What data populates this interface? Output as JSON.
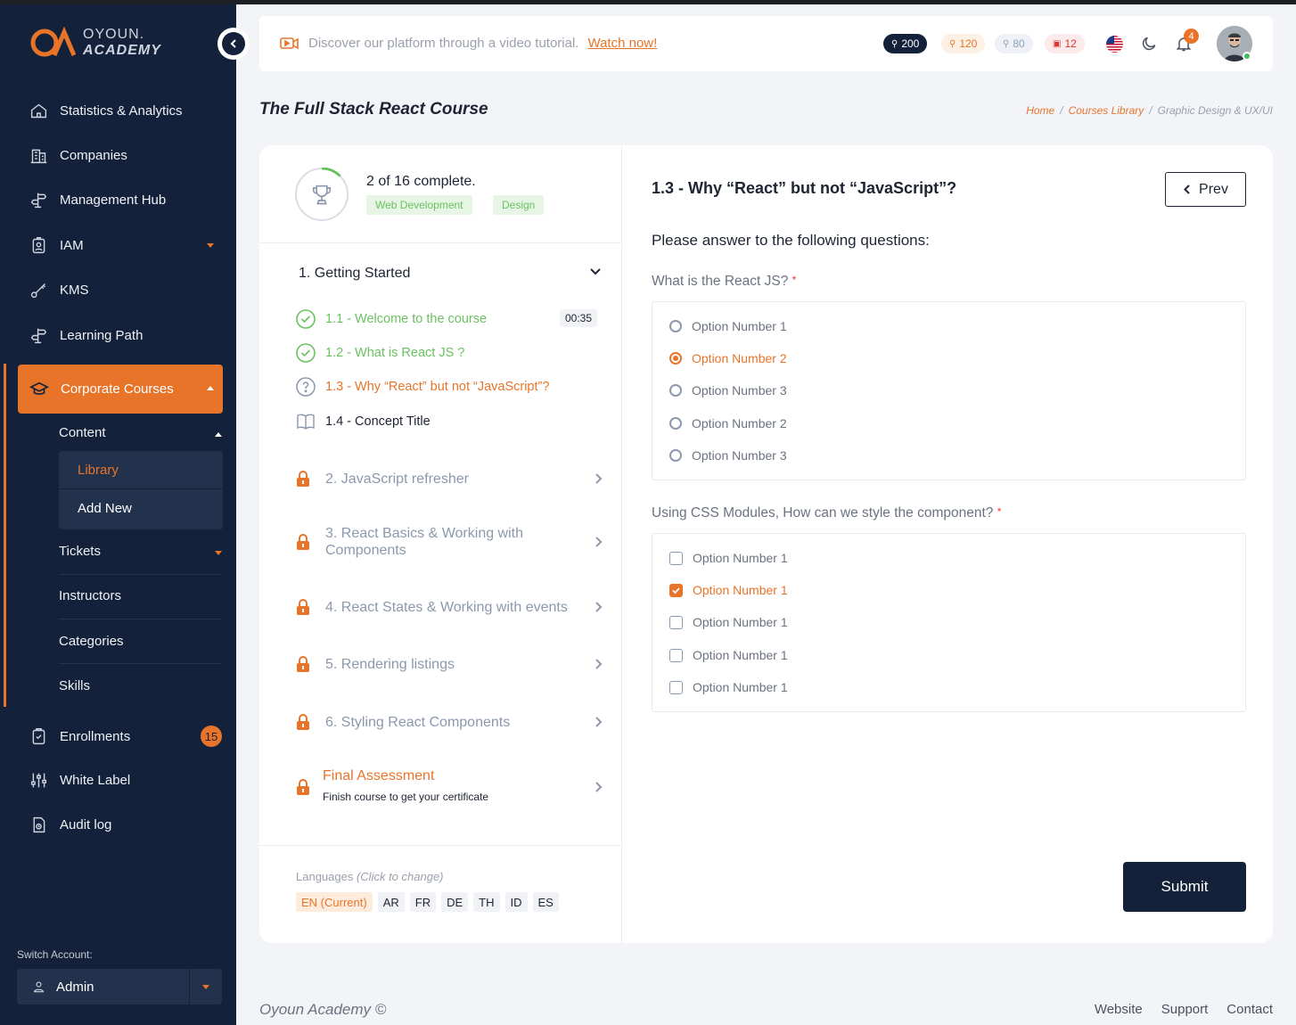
{
  "brand": {
    "line1": "OYOUN.",
    "line2": "ACADEMY"
  },
  "sidebar": {
    "items": [
      {
        "label": "Statistics & Analytics",
        "icon": "home-icon"
      },
      {
        "label": "Companies",
        "icon": "building-icon"
      },
      {
        "label": "Management Hub",
        "icon": "signpost-icon"
      },
      {
        "label": "IAM",
        "icon": "id-badge-icon"
      },
      {
        "label": "KMS",
        "icon": "key-icon"
      },
      {
        "label": "Learning Path",
        "icon": "signpost-icon"
      }
    ],
    "active": {
      "label": "Corporate Courses",
      "icon": "graduation-cap-icon"
    },
    "content": {
      "label": "Content",
      "children": [
        "Library",
        "Add New"
      ]
    },
    "subitems": [
      "Tickets",
      "Instructors",
      "Categories",
      "Skills"
    ],
    "bottom_items": [
      {
        "label": "Enrollments",
        "icon": "clipboard-check-icon",
        "badge": "15"
      },
      {
        "label": "White Label",
        "icon": "sliders-icon"
      },
      {
        "label": "Audit log",
        "icon": "log-file-icon"
      }
    ],
    "switch_label": "Switch Account:",
    "account": "Admin"
  },
  "topbar": {
    "tutorial_text": "Discover our platform through a video tutorial.",
    "tutorial_link": "Watch now!",
    "counters": [
      "200",
      "120",
      "80",
      "12"
    ],
    "notifications": "4"
  },
  "page": {
    "title": "The Full Stack React Course",
    "breadcrumb": [
      "Home",
      "Courses Library",
      "Graphic Design & UX/UI"
    ]
  },
  "course": {
    "progress_text": "2 of 16 complete.",
    "progress": 0.125,
    "tags": [
      "Web Development",
      "Design"
    ],
    "section1": "1. Getting Started",
    "lessons": [
      {
        "label": "1.1 - Welcome to the course",
        "time": "00:35"
      },
      {
        "label": "1.2 - What is React JS ?"
      },
      {
        "label": "1.3 - Why “React” but not “JavaScript”?"
      },
      {
        "label": "1.4 - Concept Title"
      }
    ],
    "locked": [
      "2. JavaScript refresher",
      "3. React Basics & Working with Components",
      "4. React States & Working with events",
      "5. Rendering listings",
      "6. Styling React Components"
    ],
    "final": {
      "title": "Final Assessment",
      "subtitle": "Finish course to get your certificate"
    },
    "languages_label": "Languages",
    "languages_hint": "(Click to change)",
    "languages": [
      "EN (Current)",
      "AR",
      "FR",
      "DE",
      "TH",
      "ID",
      "ES"
    ]
  },
  "quiz": {
    "title": "1.3 - Why “React” but not “JavaScript”?",
    "prev": "Prev",
    "instructions": "Please answer to the following questions:",
    "q1": {
      "label": "What is the React JS?",
      "options": [
        "Option Number 1",
        "Option Number 2",
        "Option Number 3",
        "Option Number 2",
        "Option Number 3"
      ],
      "selected": 1
    },
    "q2": {
      "label": "Using CSS Modules, How can we style the component?",
      "options": [
        "Option Number 1",
        "Option Number 1",
        "Option Number 1",
        "Option Number 1",
        "Option Number 1"
      ],
      "selected": 1
    },
    "required_mark": "*",
    "submit": "Submit"
  },
  "footer": {
    "copyright": "Oyoun Academy ©",
    "links": [
      "Website",
      "Support",
      "Contact"
    ]
  },
  "colors": {
    "accent": "#e8742a",
    "navy": "#13213a",
    "success": "#6bc162"
  }
}
